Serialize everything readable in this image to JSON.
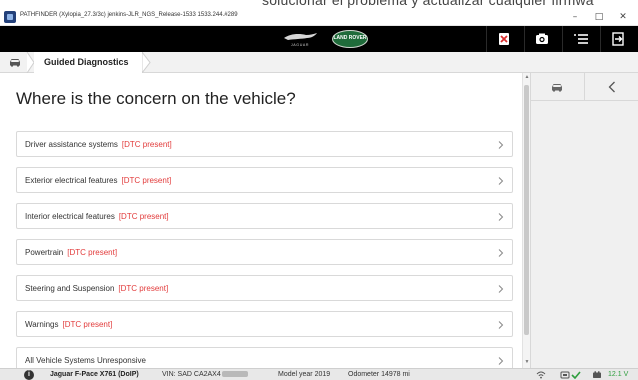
{
  "document_heading_fragment": "solucionar el problema y actualizar cualquier firmwa",
  "window": {
    "title": "PATHFINDER (Xylopia_27.3/3c) jenkins-JLR_NGS_Release-1533 1533.244.#289",
    "minimize": "–",
    "maximize": "□",
    "close": "✕"
  },
  "header": {
    "jaguar_logo_text": "JAGUAR",
    "landrover_logo_text": "LAND ROVER"
  },
  "breadcrumb": {
    "current": "Guided Diagnostics"
  },
  "main": {
    "title": "Where is the concern on the vehicle?",
    "items": [
      {
        "label": "Driver assistance systems",
        "tag": "[DTC present]"
      },
      {
        "label": "Exterior electrical features",
        "tag": "[DTC present]"
      },
      {
        "label": "Interior electrical features",
        "tag": "[DTC present]"
      },
      {
        "label": "Powertrain",
        "tag": "[DTC present]"
      },
      {
        "label": "Steering and Suspension",
        "tag": "[DTC present]"
      },
      {
        "label": "Warnings",
        "tag": "[DTC present]"
      },
      {
        "label": "All Vehicle Systems Unresponsive",
        "tag": ""
      }
    ]
  },
  "status": {
    "info_glyph": "i",
    "vehicle": "Jaguar F-Pace X761 (DoIP)",
    "vin_label": "VIN: SAD CA2AX4",
    "model_year": "Model year 2019",
    "odometer": "Odometer 14978 mi",
    "voltage": "12.1 V"
  },
  "colors": {
    "header_bg": "#000000",
    "dtc_red": "#e23b3b",
    "ok_green": "#2e9e3e",
    "landrover_green": "#1f6b3a"
  },
  "icons": {
    "header_buttons": [
      "clear-dtc-icon",
      "camera-icon",
      "menu-icon",
      "exit-icon"
    ],
    "breadcrumb": "car-icon",
    "side_panel": [
      "car-icon",
      "chevron-left-icon"
    ],
    "status": [
      "info-icon",
      "network-icon",
      "interface-icon",
      "check-icon",
      "battery-icon"
    ]
  }
}
